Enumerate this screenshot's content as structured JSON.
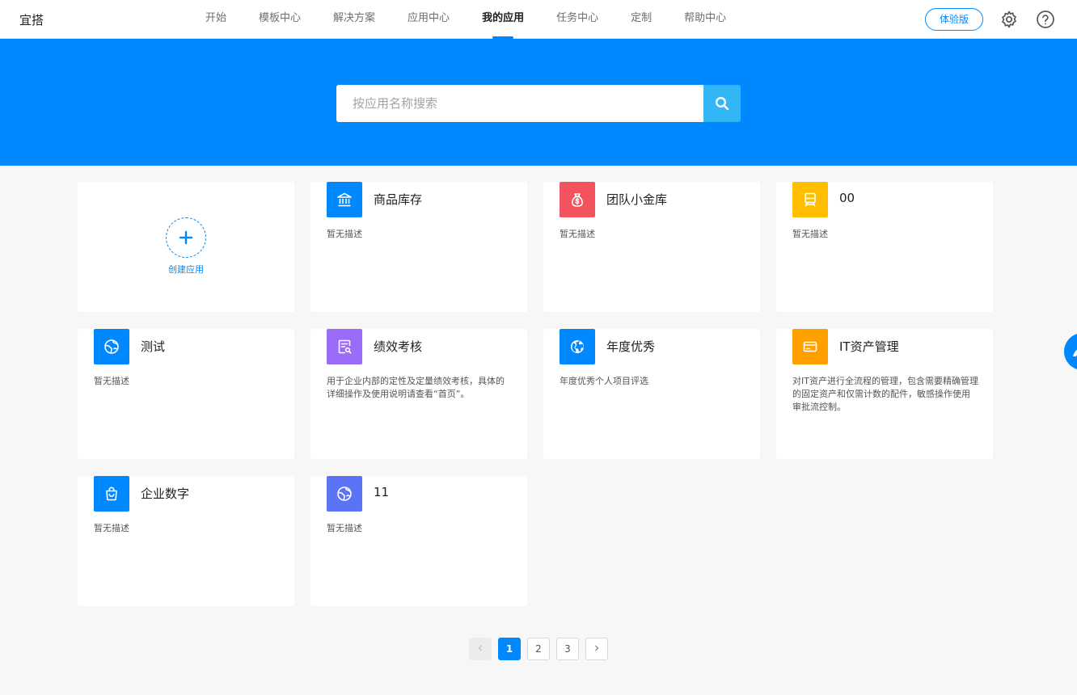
{
  "header": {
    "brand": "宜搭",
    "nav": [
      {
        "label": "开始",
        "active": false
      },
      {
        "label": "模板中心",
        "active": false
      },
      {
        "label": "解决方案",
        "active": false
      },
      {
        "label": "应用中心",
        "active": false
      },
      {
        "label": "我的应用",
        "active": true
      },
      {
        "label": "任务中心",
        "active": false
      },
      {
        "label": "定制",
        "active": false
      },
      {
        "label": "帮助中心",
        "active": false
      }
    ],
    "trial_label": "体验版",
    "settings_icon": "gear-icon",
    "help_icon": "help-icon"
  },
  "search": {
    "placeholder": "按应用名称搜索",
    "value": ""
  },
  "create": {
    "label": "创建应用"
  },
  "apps": [
    {
      "name": "商品库存",
      "desc": "暂无描述",
      "icon": "bank-icon",
      "color": "#0089ff"
    },
    {
      "name": "团队小金库",
      "desc": "暂无描述",
      "icon": "money-bag-icon",
      "color": "#f2535e"
    },
    {
      "name": "00",
      "desc": "暂无描述",
      "icon": "train-icon",
      "color": "#ffbf00"
    },
    {
      "name": "测试",
      "desc": "暂无描述",
      "icon": "globe-icon",
      "color": "#0089ff"
    },
    {
      "name": "绩效考核",
      "desc": "用于企业内部的定性及定量绩效考核，具体的详细操作及使用说明请查看“首页”。",
      "icon": "report-icon",
      "color": "#9b6cf7"
    },
    {
      "name": "年度优秀",
      "desc": "年度优秀个人项目评选",
      "icon": "earth-icon",
      "color": "#0089ff"
    },
    {
      "name": "IT资产管理",
      "desc": "对IT资产进行全流程的管理，包含需要精确管理的固定资产和仅需计数的配件，敏感操作使用审批流控制。",
      "icon": "card-icon",
      "color": "#ffa000"
    },
    {
      "name": "企业数字",
      "desc": "暂无描述",
      "icon": "bag-icon",
      "color": "#0089ff"
    },
    {
      "name": "11",
      "desc": "暂无描述",
      "icon": "globe-icon",
      "color": "#5b73f5"
    }
  ],
  "pagination": {
    "pages": [
      "1",
      "2",
      "3"
    ],
    "current": "1",
    "prev_icon": "chevron-left-icon",
    "next_icon": "chevron-right-icon"
  },
  "floating": {
    "icon": "assistant-icon"
  }
}
